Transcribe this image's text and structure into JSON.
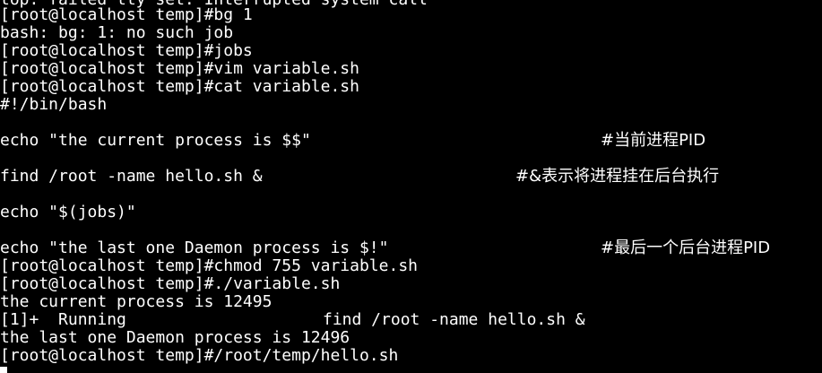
{
  "terminal": {
    "lines": [
      "top: failed tty set: Interrupted system call",
      "[root@localhost temp]#bg 1",
      "bash: bg: 1: no such job",
      "[root@localhost temp]#jobs",
      "[root@localhost temp]#vim variable.sh",
      "[root@localhost temp]#cat variable.sh",
      "#!/bin/bash",
      "echo \"the current process is $$\"",
      "find /root -name hello.sh &",
      "echo \"$(jobs)\"",
      "echo \"the last one Daemon process is $!\"",
      "[root@localhost temp]#chmod 755 variable.sh",
      "[root@localhost temp]#./variable.sh",
      "the current process is 12495",
      "[1]+  Running",
      "the last one Daemon process is 12496",
      "[root@localhost temp]#/root/temp/hello.sh"
    ],
    "comments": [
      "#当前进程PID",
      "#&表示将进程挂在后台执行",
      "#最后一个后台进程PID"
    ],
    "job_command": "find /root -name hello.sh &"
  }
}
